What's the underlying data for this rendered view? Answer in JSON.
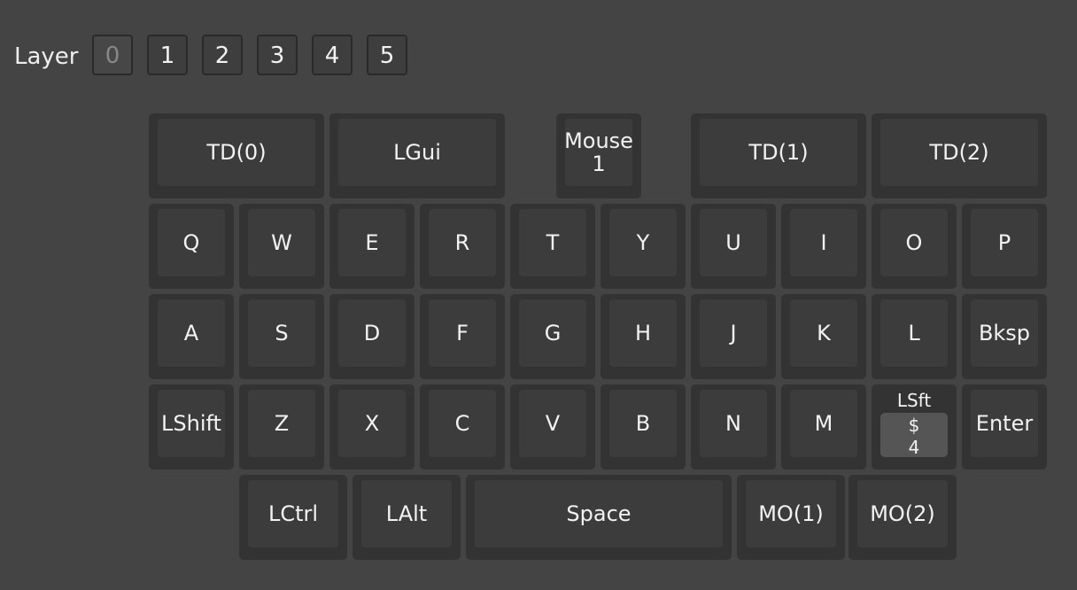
{
  "layer_selector": {
    "label": "Layer",
    "layers": [
      "0",
      "1",
      "2",
      "3",
      "4",
      "5"
    ],
    "active": "0"
  },
  "keyboard": {
    "row0": [
      "TD(0)",
      "LGui",
      "Mouse\n1",
      "TD(1)",
      "TD(2)"
    ],
    "row1": [
      "Q",
      "W",
      "E",
      "R",
      "T",
      "Y",
      "U",
      "I",
      "O",
      "P"
    ],
    "row2": [
      "A",
      "S",
      "D",
      "F",
      "G",
      "H",
      "J",
      "K",
      "L",
      "Bksp"
    ],
    "row3": [
      "LShift",
      "Z",
      "X",
      "C",
      "V",
      "B",
      "N",
      "M",
      "LSft_mod",
      "Enter"
    ],
    "mod_key": {
      "modifier": "LSft",
      "tap": "$\n4"
    },
    "row4": [
      "LCtrl",
      "LAlt",
      "Space",
      "MO(1)",
      "MO(2)"
    ]
  },
  "colors": {
    "background": "#444444",
    "key_base": "#333333",
    "key_top": "#3c3c3c",
    "mod_cap": "#555555",
    "text": "#f2f2f2",
    "active_layer_text": "#888888"
  }
}
